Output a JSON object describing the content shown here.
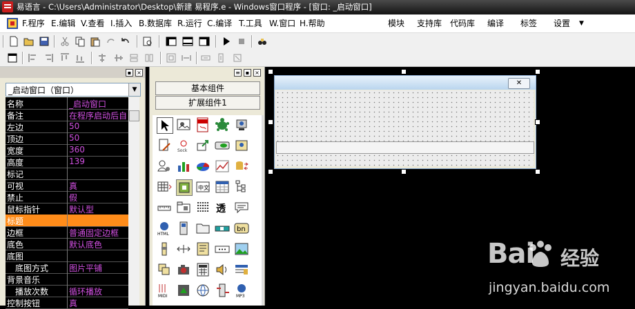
{
  "window": {
    "title": "易语言 - C:\\Users\\Administrator\\Desktop\\新建 易程序.e - Windows窗口程序 - [窗口: _启动窗口]"
  },
  "menu": {
    "items": [
      {
        "label": "F.程序",
        "key": "F"
      },
      {
        "label": "E.编辑",
        "key": "E"
      },
      {
        "label": "V.查看",
        "key": "V"
      },
      {
        "label": "I.插入",
        "key": "I"
      },
      {
        "label": "B.数据库",
        "key": "B"
      },
      {
        "label": "R.运行",
        "key": "R"
      },
      {
        "label": "C.编译",
        "key": "C"
      },
      {
        "label": "T.工具",
        "key": "T"
      },
      {
        "label": "W.窗口",
        "key": "W"
      },
      {
        "label": "H.帮助",
        "key": "H"
      }
    ],
    "right_items": [
      "模块",
      "支持库",
      "代码库",
      "编译",
      "标签",
      "设置"
    ]
  },
  "properties": {
    "selected_object": "_启动窗口（窗口）",
    "rows": [
      {
        "name": "名称",
        "value": "_启动窗口"
      },
      {
        "name": "备注",
        "value": "在程序启动后自"
      },
      {
        "name": "左边",
        "value": "50"
      },
      {
        "name": "顶边",
        "value": "50"
      },
      {
        "name": "宽度",
        "value": "360"
      },
      {
        "name": "高度",
        "value": "139"
      },
      {
        "name": "标记",
        "value": ""
      },
      {
        "name": "可视",
        "value": "真"
      },
      {
        "name": "禁止",
        "value": "假"
      },
      {
        "name": "鼠标指针",
        "value": "默认型"
      },
      {
        "name": "标题",
        "value": ""
      },
      {
        "name": "边框",
        "value": "普通固定边框"
      },
      {
        "name": "底色",
        "value": "默认底色"
      },
      {
        "name": "底图",
        "value": ""
      },
      {
        "name": "底图方式",
        "value": "图片平铺"
      },
      {
        "name": "背景音乐",
        "value": ""
      },
      {
        "name": "播放次数",
        "value": "循环播放"
      },
      {
        "name": "控制按钮",
        "value": "真"
      }
    ]
  },
  "components": {
    "basic_label": "基本组件",
    "extended_label": "扩展组件1"
  },
  "watermark": {
    "brand": "Bai",
    "brand_cn": "经验",
    "url": "jingyan.baidu.com"
  }
}
